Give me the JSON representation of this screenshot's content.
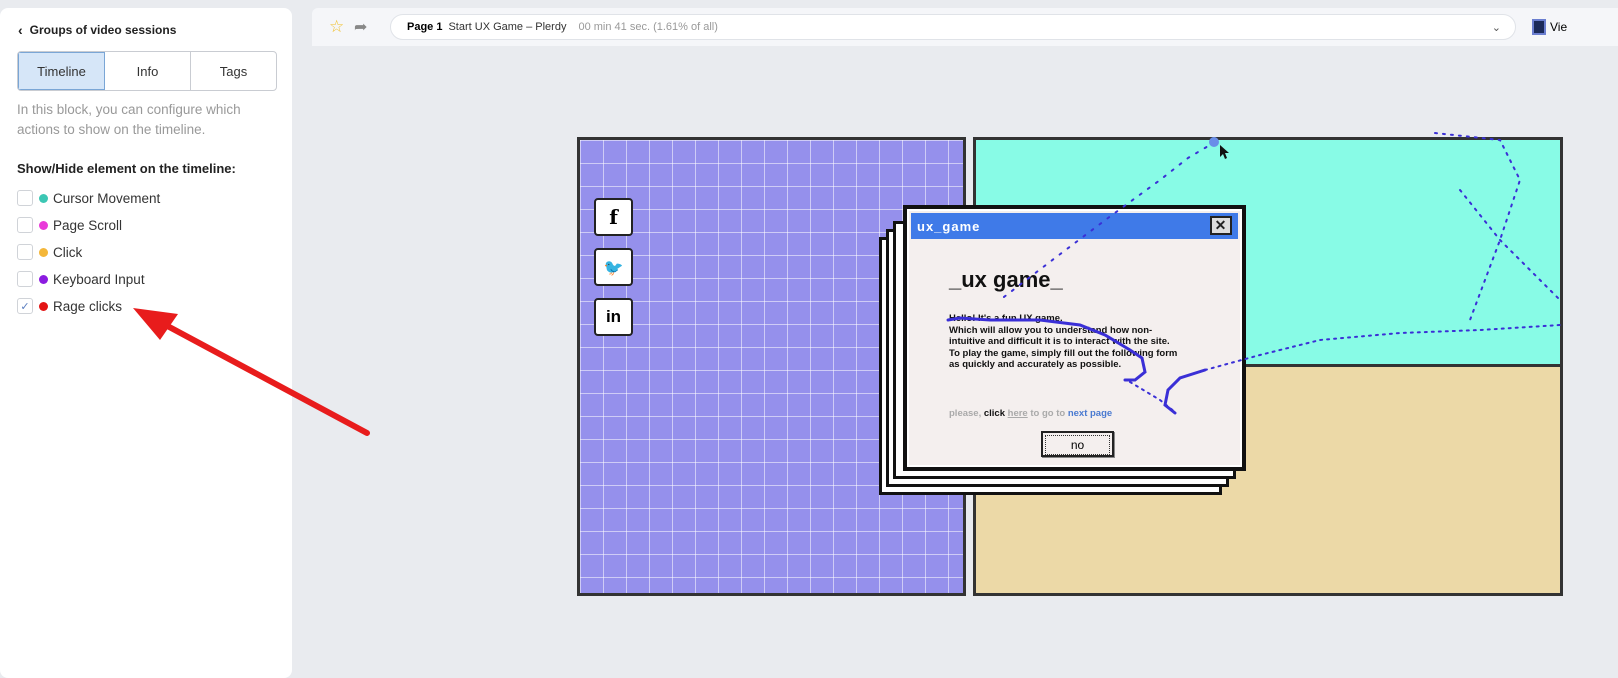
{
  "sidebar": {
    "back_label": "Groups of video sessions",
    "tabs": [
      {
        "label": "Timeline",
        "active": true
      },
      {
        "label": "Info"
      },
      {
        "label": "Tags"
      }
    ],
    "description": "In this block, you can configure which actions to show on the timeline.",
    "section_title": "Show/Hide element on the timeline:",
    "options": [
      {
        "label": "Cursor Movement",
        "color": "#3cc7b4",
        "checked": false
      },
      {
        "label": "Page Scroll",
        "color": "#e93bd9",
        "checked": false
      },
      {
        "label": "Click",
        "color": "#f4b73a",
        "checked": false
      },
      {
        "label": "Keyboard Input",
        "color": "#8b1be0",
        "checked": false
      },
      {
        "label": "Rage clicks",
        "color": "#e31515",
        "checked": true
      }
    ]
  },
  "toolbar": {
    "page_label": "Page 1",
    "page_title": "Start UX Game – Plerdy",
    "duration": "00 min 41 sec. (1.61% of all)",
    "view_label": "Vie"
  },
  "game": {
    "window_title": "ux_game",
    "close_glyph": "✕",
    "heading": "_ux game_",
    "body_lines": [
      "Hello! It's a fun UX game.",
      "Which will allow you to understand how non-",
      "intuitive and difficult it is to interact with the site.",
      "To play the game, simply fill out the following form",
      "as quickly and accurately as possible."
    ],
    "link_please": "please, ",
    "link_click": "click ",
    "link_here": "here",
    "link_goto": " to go to ",
    "link_next": "next page",
    "no_button": "no",
    "social": [
      "f",
      "🐦",
      "in"
    ]
  },
  "annotation_color": "#e81c1c",
  "trail_color": "#3a2fd6"
}
